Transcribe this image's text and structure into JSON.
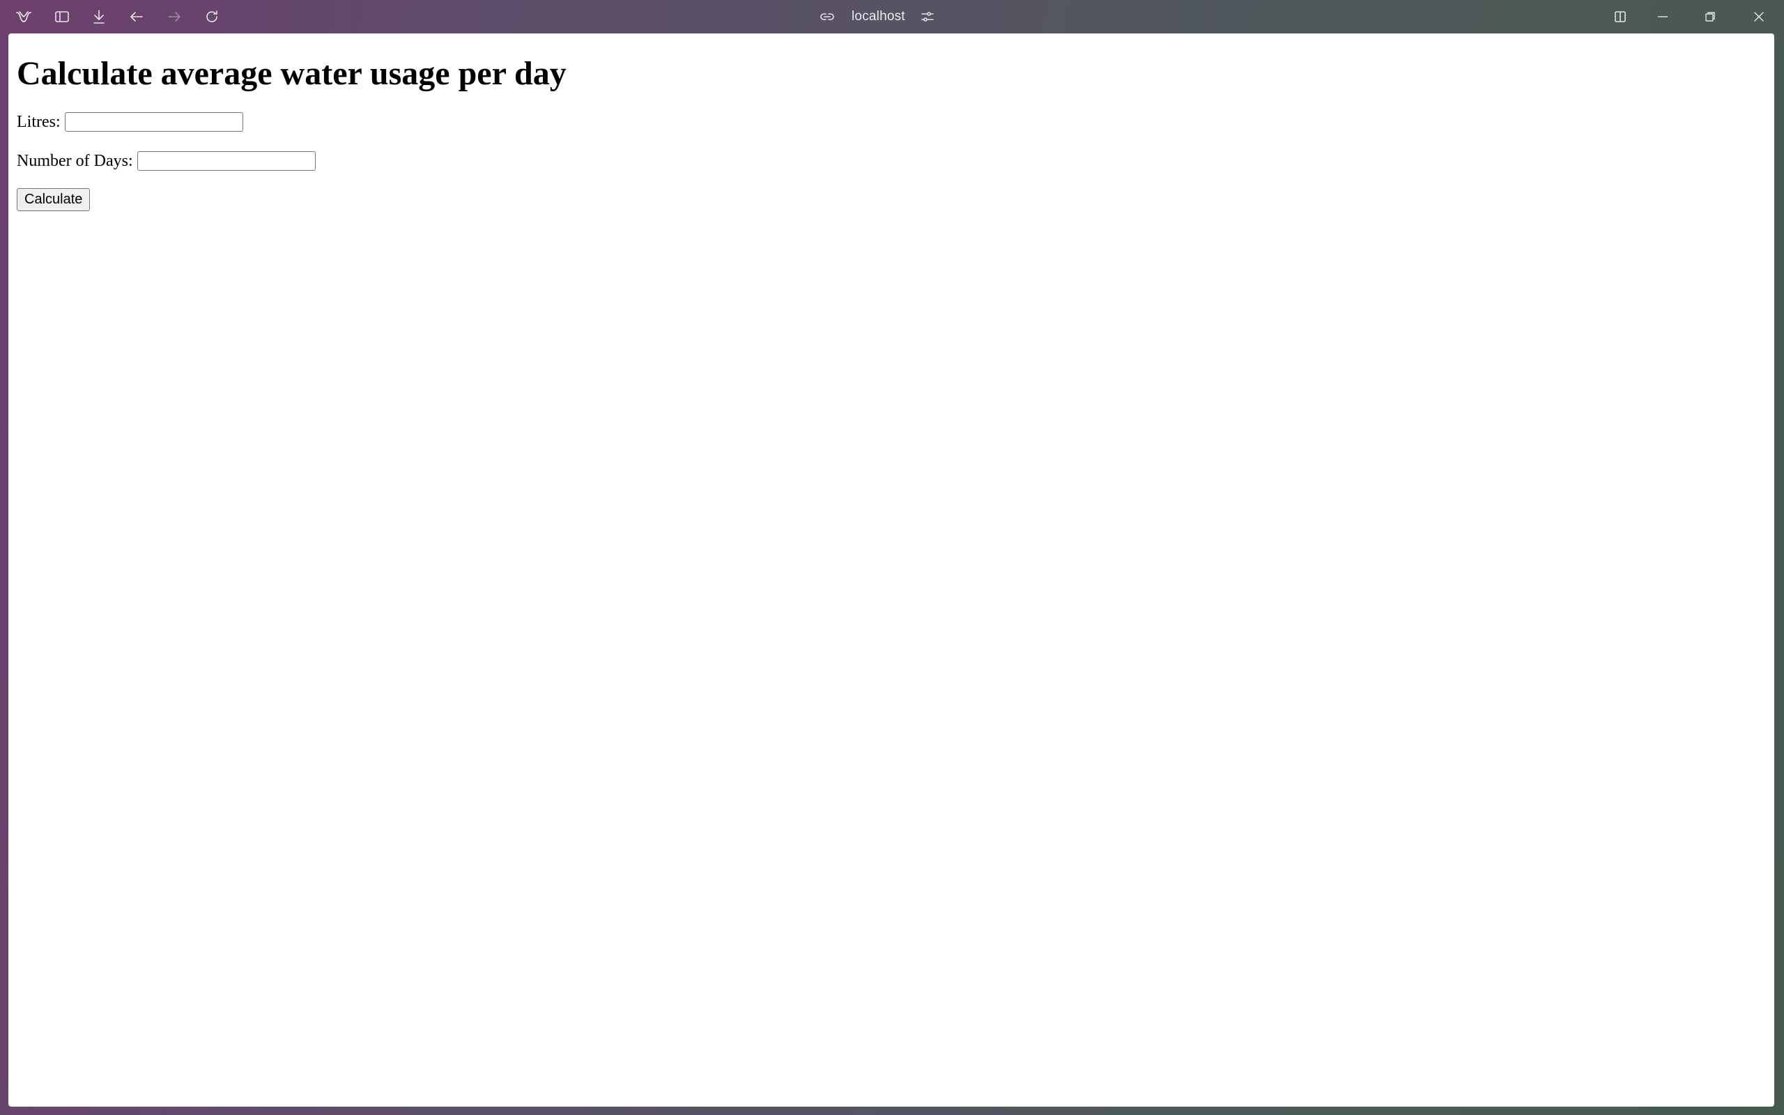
{
  "browser": {
    "address": "localhost",
    "icons": {
      "app_logo": "browser-logo-icon",
      "sidebar": "sidebar-toggle-icon",
      "downloads": "download-icon",
      "back": "arrow-left-icon",
      "forward": "arrow-right-icon",
      "reload": "reload-icon",
      "link": "link-icon",
      "site_settings": "sliders-icon",
      "split_view": "split-view-icon",
      "minimize": "minimize-icon",
      "restore": "restore-icon",
      "close": "close-icon"
    },
    "forward_enabled": false
  },
  "page": {
    "title": "Calculate average water usage per day",
    "litres_label": "Litres:",
    "litres_value": "",
    "days_label": "Number of Days:",
    "days_value": "",
    "calculate_label": "Calculate"
  },
  "colors": {
    "titlebar_gradient_start": "#6e3f6e",
    "titlebar_gradient_end": "#465a50",
    "page_background": "#ffffff"
  }
}
